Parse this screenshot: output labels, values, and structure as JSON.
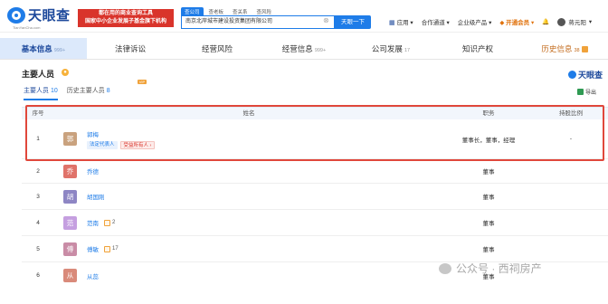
{
  "header": {
    "logo_text": "天眼查",
    "logo_sub": "TianYanCha.com",
    "banner_line1": "国家中小企业发展子基金旗下机构",
    "banner_line0": "都在用的商业查询工具",
    "search_tabs": [
      "查公司",
      "查老板",
      "查关系",
      "查风险"
    ],
    "search_value": "南京北岸城市建设投资集团有限公司",
    "search_button": "天眼一下",
    "nav": {
      "app": "应用",
      "partner": "合作通道",
      "enterprise": "企业级产品",
      "vip": "开通会员",
      "user": "蒋元阳"
    }
  },
  "main_tabs": [
    {
      "label": "基本信息",
      "count": "999+"
    },
    {
      "label": "法律诉讼",
      "count": ""
    },
    {
      "label": "经营风险",
      "count": ""
    },
    {
      "label": "经营信息",
      "count": "999+"
    },
    {
      "label": "公司发展",
      "count": "17"
    },
    {
      "label": "知识产权",
      "count": ""
    },
    {
      "label": "历史信息",
      "count": "38"
    }
  ],
  "section": {
    "title": "主要人员",
    "brand": "天眼查",
    "sub_tabs": [
      {
        "label": "主要人员",
        "count": "10"
      },
      {
        "label": "历史主要人员",
        "count": "8"
      }
    ],
    "vip_tag": "VIP",
    "export": "导出"
  },
  "table": {
    "headers": [
      "序号",
      "姓名",
      "职务",
      "持股比例"
    ],
    "rows": [
      {
        "no": "1",
        "avatar": "郭",
        "avatar_color": "#c9a27e",
        "name": "郭梅",
        "tags": [
          "法定代表人",
          "受益所有人"
        ],
        "assoc": "",
        "position": "董事长，董事，经理",
        "ratio": "-"
      },
      {
        "no": "2",
        "avatar": "乔",
        "avatar_color": "#e0736a",
        "name": "乔德",
        "tags": [],
        "assoc": "",
        "position": "董事",
        "ratio": "-"
      },
      {
        "no": "3",
        "avatar": "胡",
        "avatar_color": "#8e86c4",
        "name": "胡国刚",
        "tags": [],
        "assoc": "",
        "position": "董事",
        "ratio": "-"
      },
      {
        "no": "4",
        "avatar": "范",
        "avatar_color": "#c59fe0",
        "name": "范南",
        "tags": [],
        "assoc": "2",
        "position": "董事",
        "ratio": "-"
      },
      {
        "no": "5",
        "avatar": "傅",
        "avatar_color": "#c98ca6",
        "name": "傅敏",
        "tags": [],
        "assoc": "17",
        "position": "董事",
        "ratio": "-"
      },
      {
        "no": "6",
        "avatar": "从",
        "avatar_color": "#d98a7a",
        "name": "从蕊",
        "tags": [],
        "assoc": "",
        "position": "董事",
        "ratio": "-"
      }
    ]
  },
  "watermark": "公众号 · 西祠房产",
  "colors": {
    "brand": "#1e7ce8",
    "highlight": "#e0473b",
    "history": "#c36b1c"
  }
}
